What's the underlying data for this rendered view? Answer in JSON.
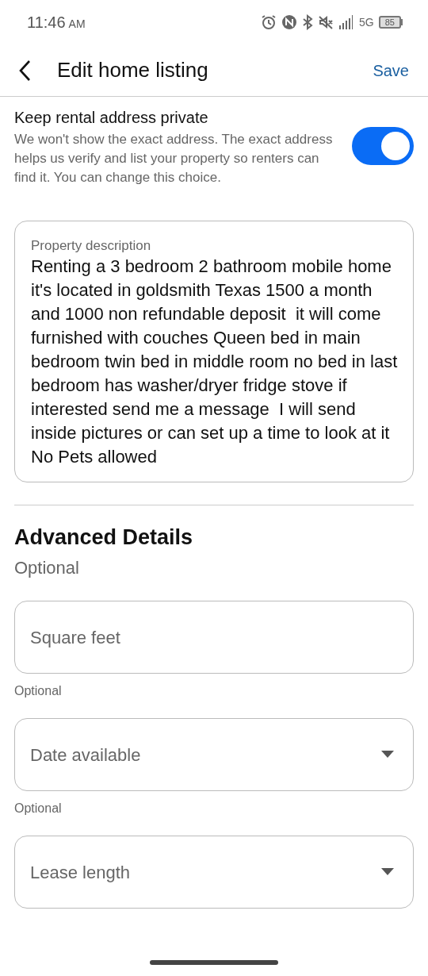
{
  "status_bar": {
    "time": "11:46",
    "ampm": "AM",
    "network": "5G",
    "battery": "85"
  },
  "header": {
    "title": "Edit home listing",
    "action": "Save"
  },
  "privacy": {
    "title": "Keep rental address private",
    "description": "We won't show the exact address. The exact address helps us verify and list your property so renters can find it. You can change this choice.",
    "on": true
  },
  "description_field": {
    "label": "Property description",
    "value": "Renting a 3 bedroom 2 bathroom mobile home it's located in goldsmith Texas 1500 a month and 1000 non refundable deposit  it will come furnished with couches Queen bed in main bedroom twin bed in middle room no bed in last bedroom has washer/dryer fridge stove if interested send me a message  I will send inside pictures or can set up a time to look at it No Pets allowed"
  },
  "advanced": {
    "title": "Advanced Details",
    "subtitle": "Optional",
    "fields": [
      {
        "kind": "text",
        "placeholder": "Square feet",
        "helper": "Optional"
      },
      {
        "kind": "select",
        "placeholder": "Date available",
        "helper": "Optional"
      },
      {
        "kind": "select",
        "placeholder": "Lease length"
      }
    ]
  }
}
